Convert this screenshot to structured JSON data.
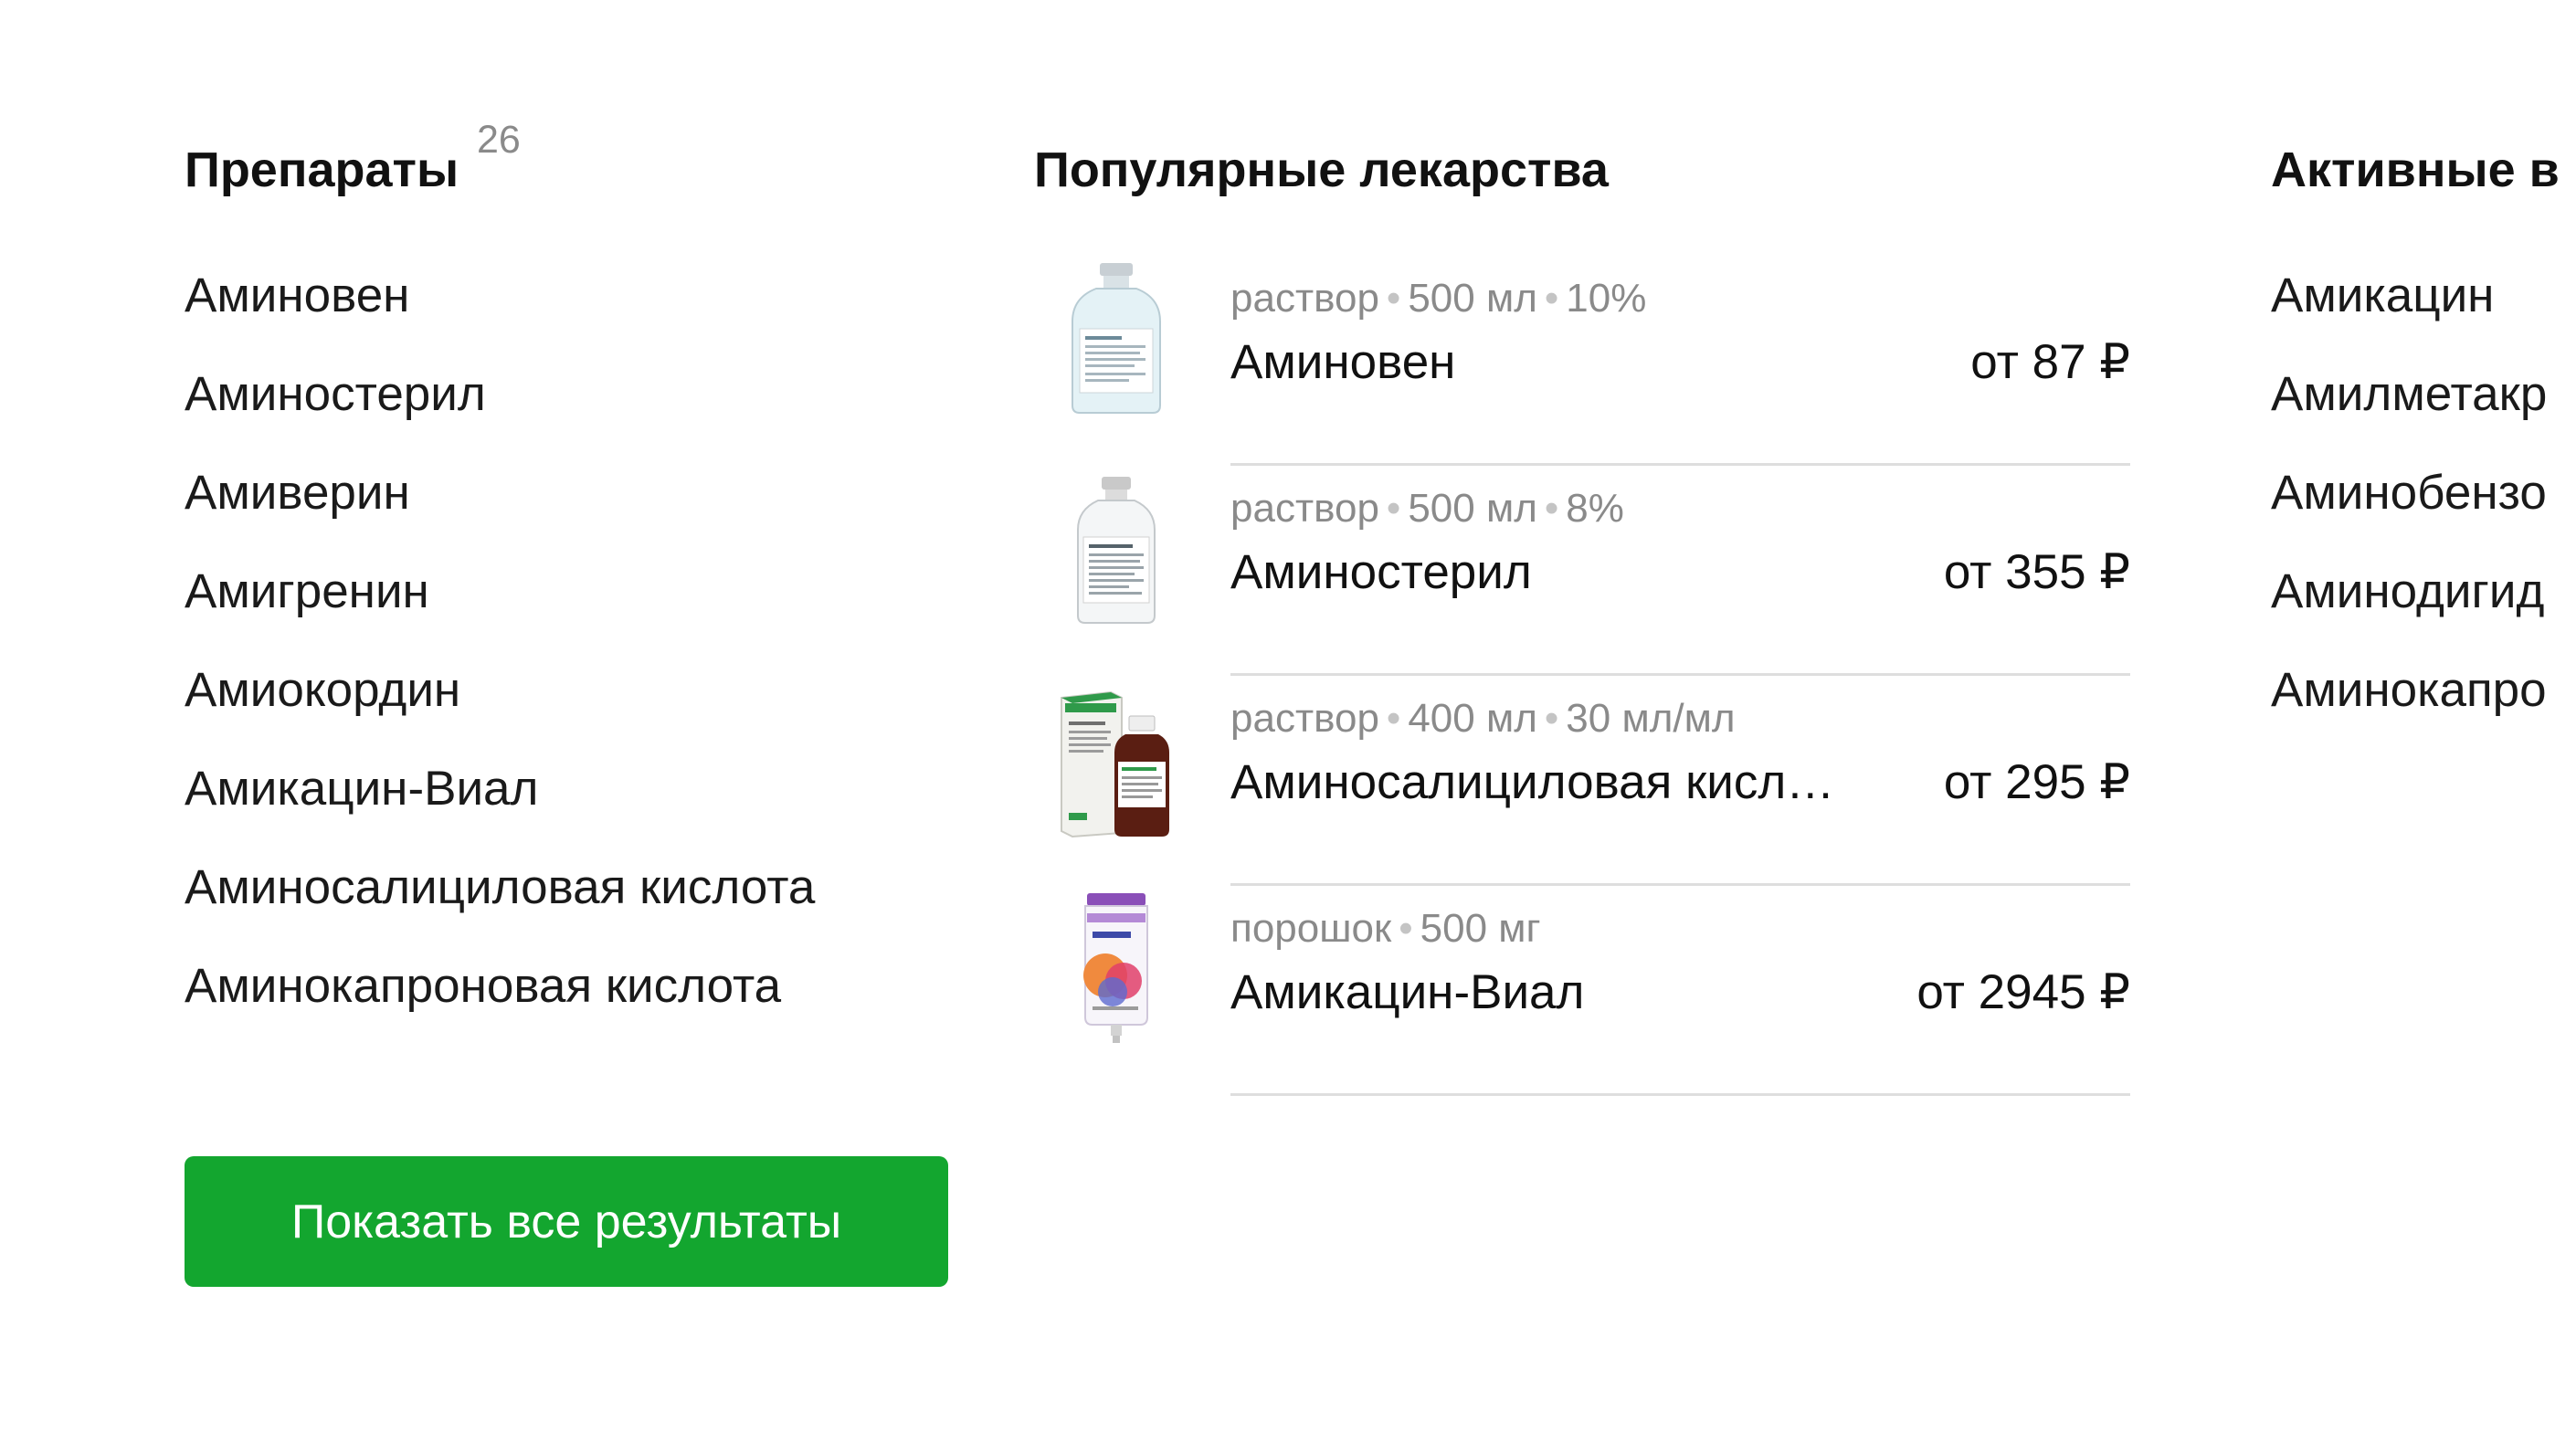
{
  "drugs": {
    "title": "Препараты",
    "count": "26",
    "items": [
      "Аминовен",
      "Аминостерил",
      "Амиверин",
      "Амигренин",
      "Амиокордин",
      "Амикацин-Виал",
      "Аминосалициловая кислота",
      "Аминокапроновая кислота"
    ],
    "show_all_label": "Показать все результаты"
  },
  "popular": {
    "title": "Популярные лекарства",
    "items": [
      {
        "form": "раствор",
        "volume": "500 мл",
        "strength": "10%",
        "name": "Аминовен",
        "price": "от 87 ₽",
        "image": "iv-bottle-icon"
      },
      {
        "form": "раствор",
        "volume": "500 мл",
        "strength": "8%",
        "name": "Аминостерил",
        "price": "от 355 ₽",
        "image": "iv-bottle-icon"
      },
      {
        "form": "раствор",
        "volume": "400 мл",
        "strength": "30 мл/мл",
        "name": "Аминосалициловая кисл…",
        "price": "от 295 ₽",
        "image": "box-and-bottle-icon"
      },
      {
        "form": "порошок",
        "volume": "500 мг",
        "name": "Амикацин-Виал",
        "price": "от 2945 ₽",
        "image": "nutrition-pack-icon"
      }
    ]
  },
  "active": {
    "title": "Активные в",
    "items": [
      "Амикацин",
      "Амилметакр",
      "Аминобензо",
      "Аминодигид",
      "Аминокапро"
    ]
  },
  "colors": {
    "accent": "#13a62f",
    "muted_text": "#8a8a8a",
    "divider": "#dedede"
  }
}
